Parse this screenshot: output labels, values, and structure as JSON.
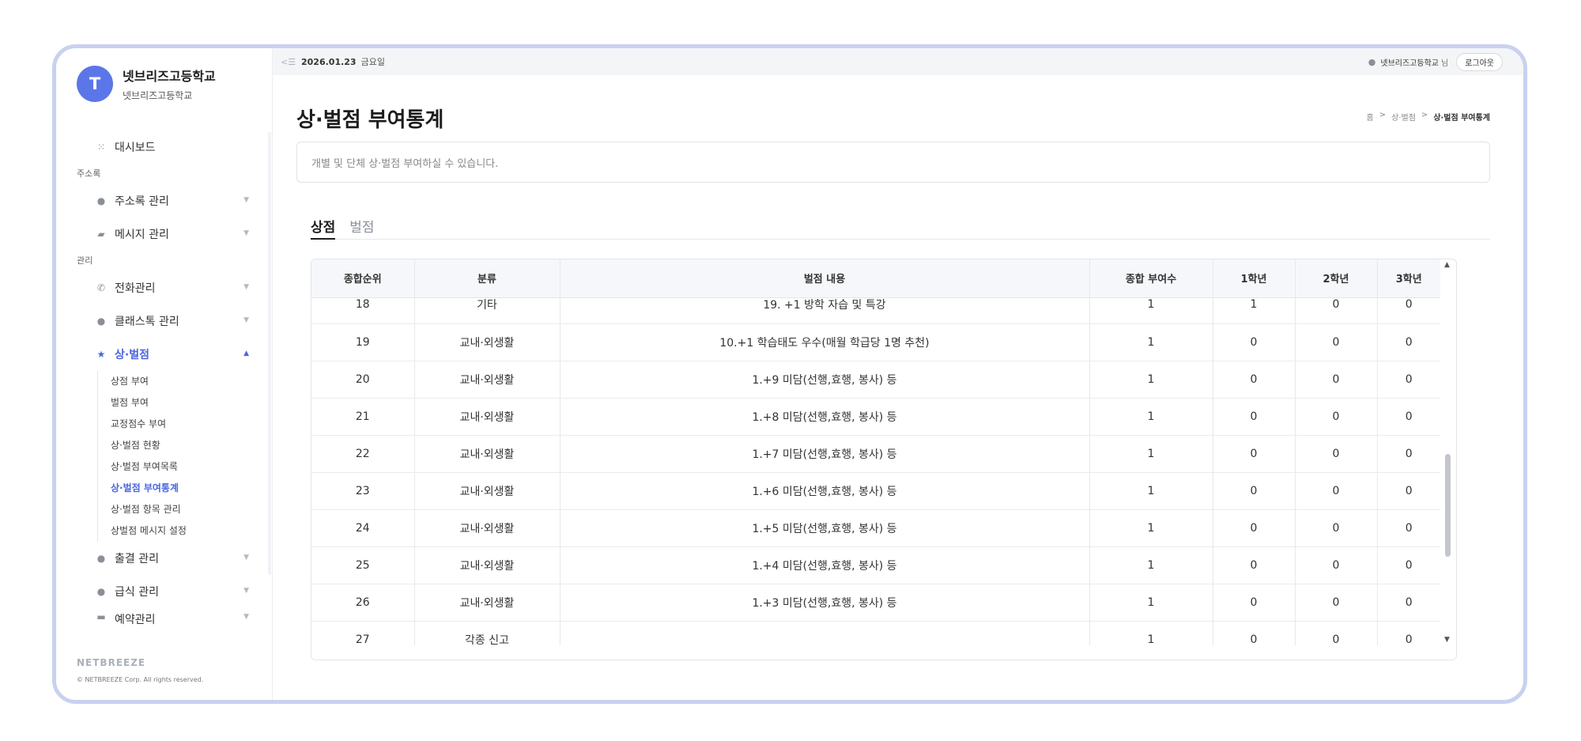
{
  "brand": {
    "initial": "T",
    "name": "넷브리즈고등학교",
    "sub": "넷브리즈고등학교"
  },
  "sidebar": {
    "dashboard": "대시보드",
    "section_address": "주소록",
    "address_mgmt": "주소록 관리",
    "message_mgmt": "메시지 관리",
    "section_admin": "관리",
    "phone_mgmt": "전화관리",
    "classtalk_mgmt": "클래스톡 관리",
    "merit": "상·벌점",
    "sub": [
      "상점 부여",
      "벌점 부여",
      "교정점수 부여",
      "상·벌점 현황",
      "상·벌점 부여목록",
      "상·벌점 부여통계",
      "상·벌점 항목 관리",
      "상벌점 메시지 설정"
    ],
    "attendance_mgmt": "출결 관리",
    "meal_mgmt": "급식 관리",
    "reservation_mgmt": "예약관리",
    "footer_logo": "NETBREEZE",
    "footer_copy": "© NETBREEZE Corp. All rights reserved."
  },
  "topbar": {
    "date": "2026.01.23",
    "weekday": "금요일",
    "user": "넷브리즈고등학교",
    "user_suffix": "님",
    "logout": "로그아웃"
  },
  "page": {
    "title": "상·벌점 부여통계",
    "breadcrumb": [
      "홈",
      ">",
      "상·벌점",
      ">",
      "상·벌점 부여통계"
    ],
    "description": "개별 및 단체 상·벌점 부여하실 수 있습니다.",
    "tabs": [
      "상점",
      "벌점"
    ]
  },
  "table": {
    "headers": [
      "종합순위",
      "분류",
      "벌점 내용",
      "종합 부여수",
      "1학년",
      "2학년",
      "3학년"
    ],
    "rows": [
      [
        "18",
        "기타",
        "19. +1 방학 자습 및 특강",
        "1",
        "1",
        "0",
        "0"
      ],
      [
        "19",
        "교내·외생활",
        "10.+1 학습태도 우수(매월 학급당 1명 추천)",
        "1",
        "0",
        "0",
        "0"
      ],
      [
        "20",
        "교내·외생활",
        "1.+9 미담(선행,효행, 봉사) 등",
        "1",
        "0",
        "0",
        "0"
      ],
      [
        "21",
        "교내·외생활",
        "1.+8 미담(선행,효행, 봉사) 등",
        "1",
        "0",
        "0",
        "0"
      ],
      [
        "22",
        "교내·외생활",
        "1.+7 미담(선행,효행, 봉사) 등",
        "1",
        "0",
        "0",
        "0"
      ],
      [
        "23",
        "교내·외생활",
        "1.+6 미담(선행,효행, 봉사) 등",
        "1",
        "0",
        "0",
        "0"
      ],
      [
        "24",
        "교내·외생활",
        "1.+5 미담(선행,효행, 봉사) 등",
        "1",
        "0",
        "0",
        "0"
      ],
      [
        "25",
        "교내·외생활",
        "1.+4 미담(선행,효행, 봉사) 등",
        "1",
        "0",
        "0",
        "0"
      ],
      [
        "26",
        "교내·외생활",
        "1.+3 미담(선행,효행, 봉사) 등",
        "1",
        "0",
        "0",
        "0"
      ],
      [
        "27",
        "각종 신고",
        "",
        "1",
        "0",
        "0",
        "0"
      ]
    ]
  }
}
